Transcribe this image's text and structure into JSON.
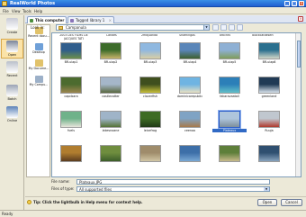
{
  "window": {
    "title": "RealWorld Photos"
  },
  "menu": [
    "File",
    "View",
    "Tools",
    "Help"
  ],
  "nav": [
    {
      "label": "Create",
      "color": "#c9cbd6"
    },
    {
      "label": "Open",
      "color": "#7a8599"
    },
    {
      "label": "Recent",
      "color": "#b9bfca"
    },
    {
      "label": "Batch",
      "color": "#9aa3b4"
    },
    {
      "label": "Online",
      "color": "#5b82b8"
    }
  ],
  "tabs": [
    {
      "label": "This computer"
    },
    {
      "label": "Tagged library 1"
    }
  ],
  "places": [
    {
      "label": "Recent docu...",
      "color": "#e1c26a"
    },
    {
      "label": "Desktop",
      "color": "#6fa0d8"
    },
    {
      "label": "My Docume...",
      "color": "#e1c26a"
    },
    {
      "label": "My Compu...",
      "color": "#9cb0c8"
    }
  ],
  "look_in": {
    "label": "Look in:",
    "value": "Campanula"
  },
  "top_labels": [
    "2003 DES FILMS DE JACQUES TATI",
    "Landes",
    "2mdjuanda",
    "Sflamingos",
    "artichtv",
    "blackcatdesert"
  ],
  "thumbnails": [
    {
      "caption": "BR-uiap1",
      "colors": [
        "#2f5d8c",
        "#6d8f4a"
      ]
    },
    {
      "caption": "BR-uiap2",
      "colors": [
        "#3c6b2a",
        "#c7b46a"
      ]
    },
    {
      "caption": "BR-uiap3",
      "colors": [
        "#8fb8e0",
        "#d9cfa5"
      ]
    },
    {
      "caption": "BR-uiap4",
      "colors": [
        "#5a86b9",
        "#3d5f2c"
      ]
    },
    {
      "caption": "BR-uiap5",
      "colors": [
        "#8eb0d4",
        "#7f9c5a"
      ]
    },
    {
      "caption": "BR-uiap6",
      "colors": [
        "#2a6f8e",
        "#d3d7c8"
      ]
    },
    {
      "caption": "capcbara",
      "colors": [
        "#4c6b2f",
        "#9c8650"
      ]
    },
    {
      "caption": "castlecatter",
      "colors": [
        "#a5b6c9",
        "#59683f"
      ]
    },
    {
      "caption": "cloverfish",
      "colors": [
        "#3f4f1e",
        "#c8c03a"
      ]
    },
    {
      "caption": "dominicarepublic",
      "colors": [
        "#6fb4e2",
        "#e9e1c3"
      ]
    },
    {
      "caption": "fakaravaatoll",
      "colors": [
        "#2c7fb8",
        "#62c0c9"
      ]
    },
    {
      "caption": "greenland",
      "colors": [
        "#203a55",
        "#d9e3ec"
      ]
    },
    {
      "caption": "fuels",
      "colors": [
        "#6fb28a",
        "#e6e4da"
      ]
    },
    {
      "caption": "lakesnoane",
      "colors": [
        "#9fb4c8",
        "#557237"
      ]
    },
    {
      "caption": "leicefrog",
      "colors": [
        "#3d6b24",
        "#1f3a16"
      ]
    },
    {
      "caption": "ceenoo",
      "colors": [
        "#7fa3c4",
        "#a67a4c"
      ]
    },
    {
      "caption": "Plateaux",
      "colors": [
        "#aec5dc",
        "#7d8e9b"
      ]
    },
    {
      "caption": "Ruuja",
      "colors": [
        "#c0c7cf",
        "#b03a2e"
      ]
    },
    {
      "caption": "",
      "colors": [
        "#b07d2f",
        "#5b3b1f"
      ]
    },
    {
      "caption": "",
      "colors": [
        "#6f8d3e",
        "#3c5e2a"
      ]
    },
    {
      "caption": "",
      "colors": [
        "#9f8c6b",
        "#d1c6a4"
      ]
    },
    {
      "caption": "",
      "colors": [
        "#3d6fa8",
        "#79a8d4"
      ]
    },
    {
      "caption": "",
      "colors": [
        "#5e7f3a",
        "#c8b98a"
      ]
    },
    {
      "caption": "",
      "colors": [
        "#2f4f70",
        "#87a2bd"
      ]
    }
  ],
  "selected_index": 16,
  "file_name": {
    "label": "File name:",
    "value": "Plateaux.JPG"
  },
  "file_type": {
    "label": "Files of type:",
    "value": "All supported files"
  },
  "hint": "Tip: Click the lightbulb in Help menu for context help.",
  "buttons": {
    "open": "Open",
    "cancel": "Cancel"
  },
  "status": "Ready"
}
